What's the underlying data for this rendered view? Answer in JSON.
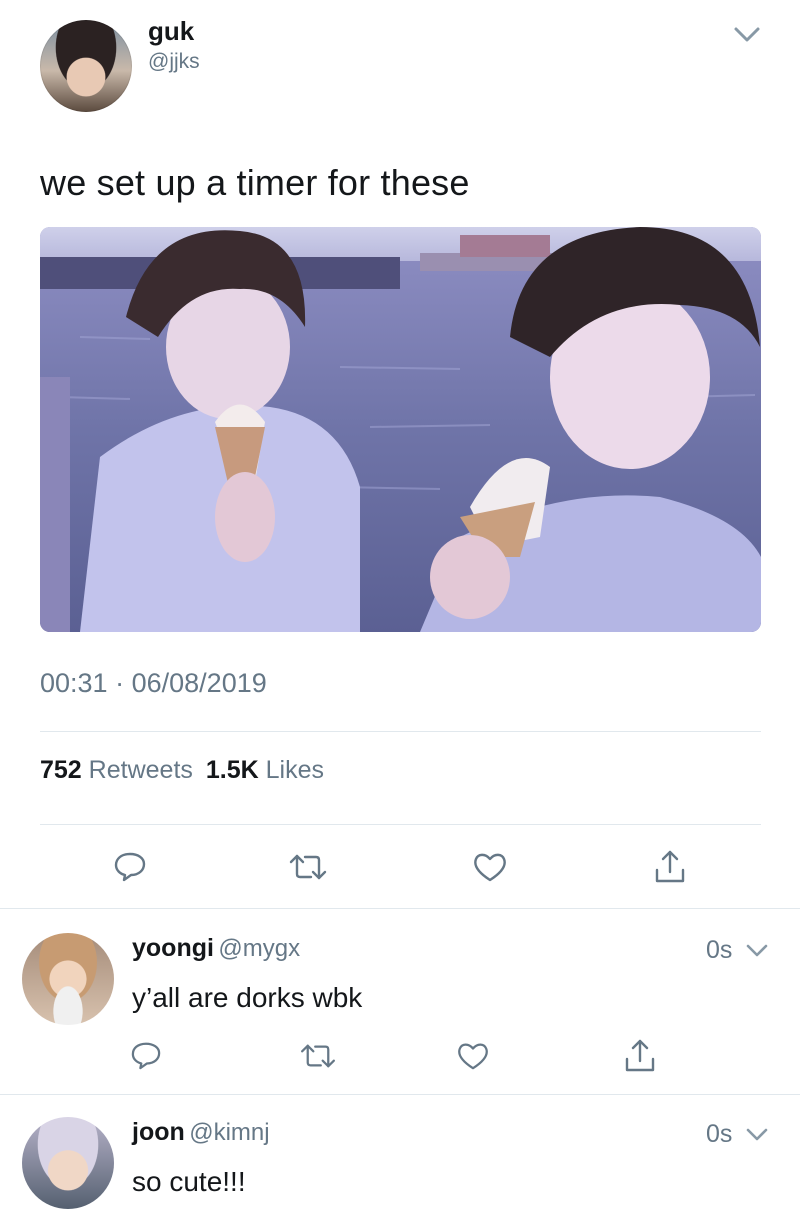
{
  "tweet": {
    "display_name": "guk",
    "handle": "@jjks",
    "text": "we set up a timer for these",
    "time": "00:31",
    "separator": "·",
    "date": "06/08/2019",
    "retweet_count": "752",
    "retweet_label": "Retweets",
    "like_count": "1.5K",
    "like_label": "Likes",
    "photo_description_icon": "photo"
  },
  "actions": {
    "icons": [
      "reply-icon",
      "retweet-icon",
      "like-icon",
      "share-icon"
    ]
  },
  "replies": [
    {
      "display_name": "yoongi",
      "handle": "@mygx",
      "time": "0s",
      "text": "y’all are dorks wbk"
    },
    {
      "display_name": "joon",
      "handle": "@kimnj",
      "time": "0s",
      "text": "so cute!!!"
    }
  ],
  "colors": {
    "primary_text": "#14171a",
    "secondary_text": "#657786",
    "divider": "#e1e8ed",
    "icon": "#657786"
  }
}
